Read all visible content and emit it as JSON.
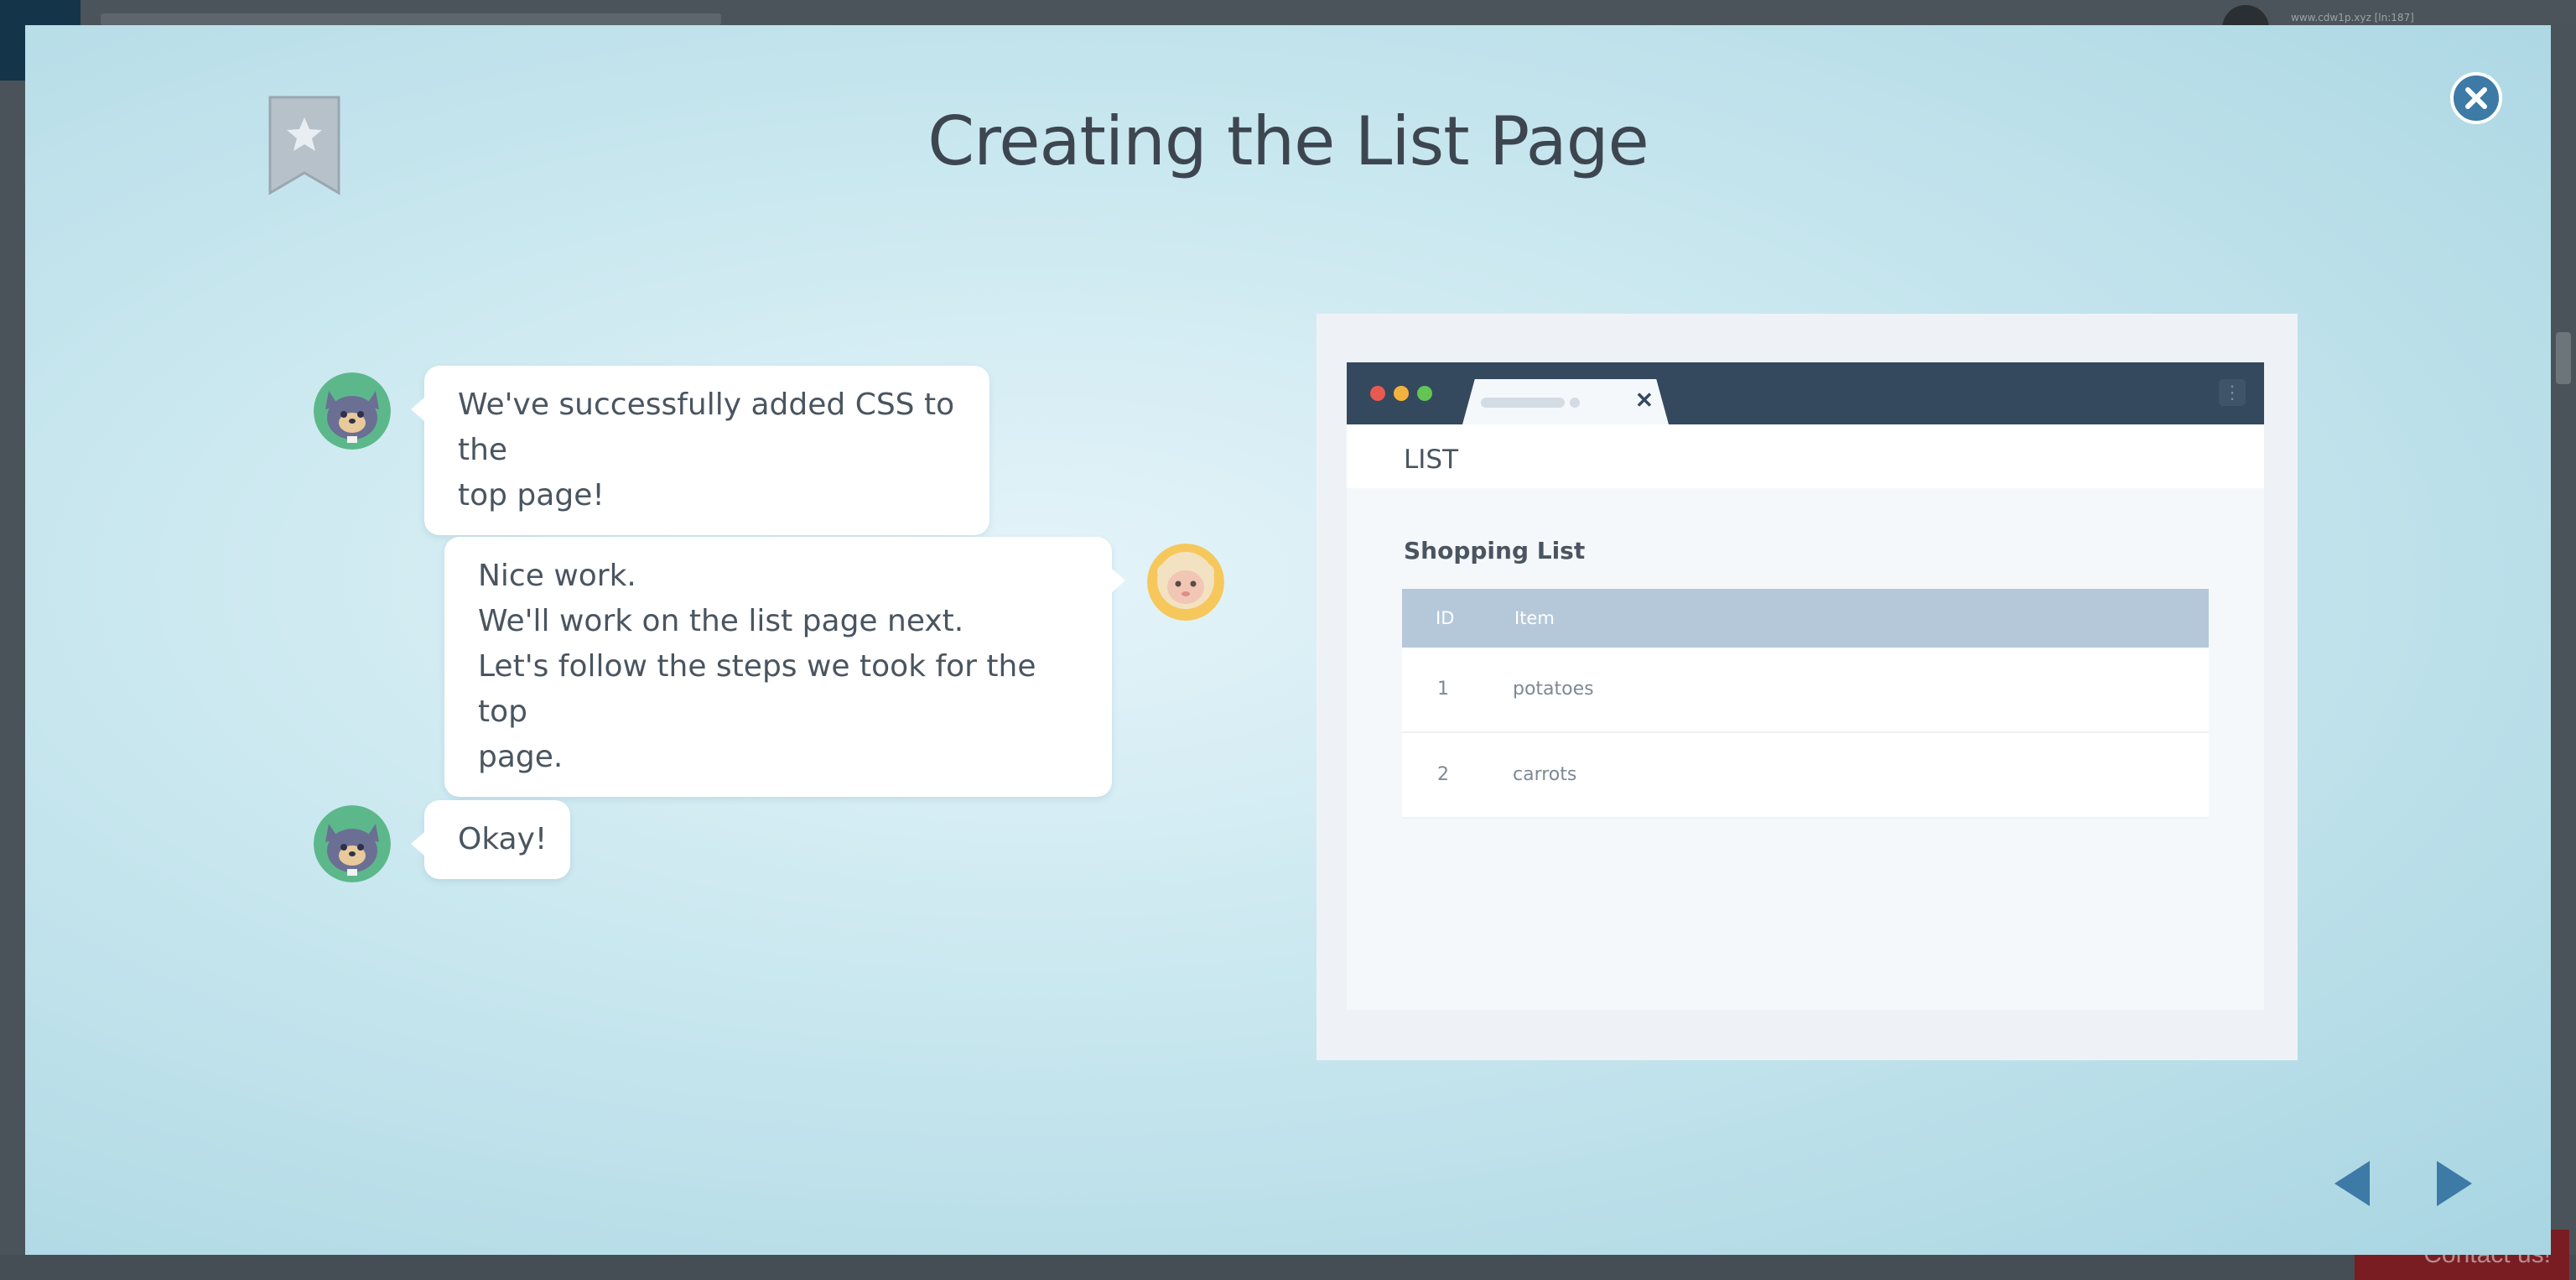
{
  "background": {
    "user_text": "www.cdw1p.xyz [ln:187]",
    "contact_label": "Contact us!"
  },
  "modal": {
    "title": "Creating the List Page",
    "close_icon": "close-icon",
    "bookmark_icon": "bookmark-star-icon",
    "accent_color": "#3d7aa6"
  },
  "chat": {
    "messages": [
      {
        "speaker": "cat",
        "side": "left",
        "lines": [
          "We've successfully added CSS to the",
          "top page!"
        ]
      },
      {
        "speaker": "sheep",
        "side": "right",
        "lines": [
          "Nice work.",
          "We'll work on the list page next.",
          "Let's follow the steps we took for the top",
          "page."
        ]
      },
      {
        "speaker": "cat",
        "side": "left",
        "lines": [
          "Okay!"
        ]
      }
    ]
  },
  "preview": {
    "app_title": "LIST",
    "list_heading": "Shopping List",
    "columns": [
      "ID",
      "Item"
    ],
    "rows": [
      {
        "id": "1",
        "item": "potatoes"
      },
      {
        "id": "2",
        "item": "carrots"
      }
    ],
    "tab_close_icon": "close-icon",
    "menu_icon": "kebab-menu-icon"
  },
  "navigation": {
    "prev_icon": "arrow-left-icon",
    "next_icon": "arrow-right-icon"
  }
}
